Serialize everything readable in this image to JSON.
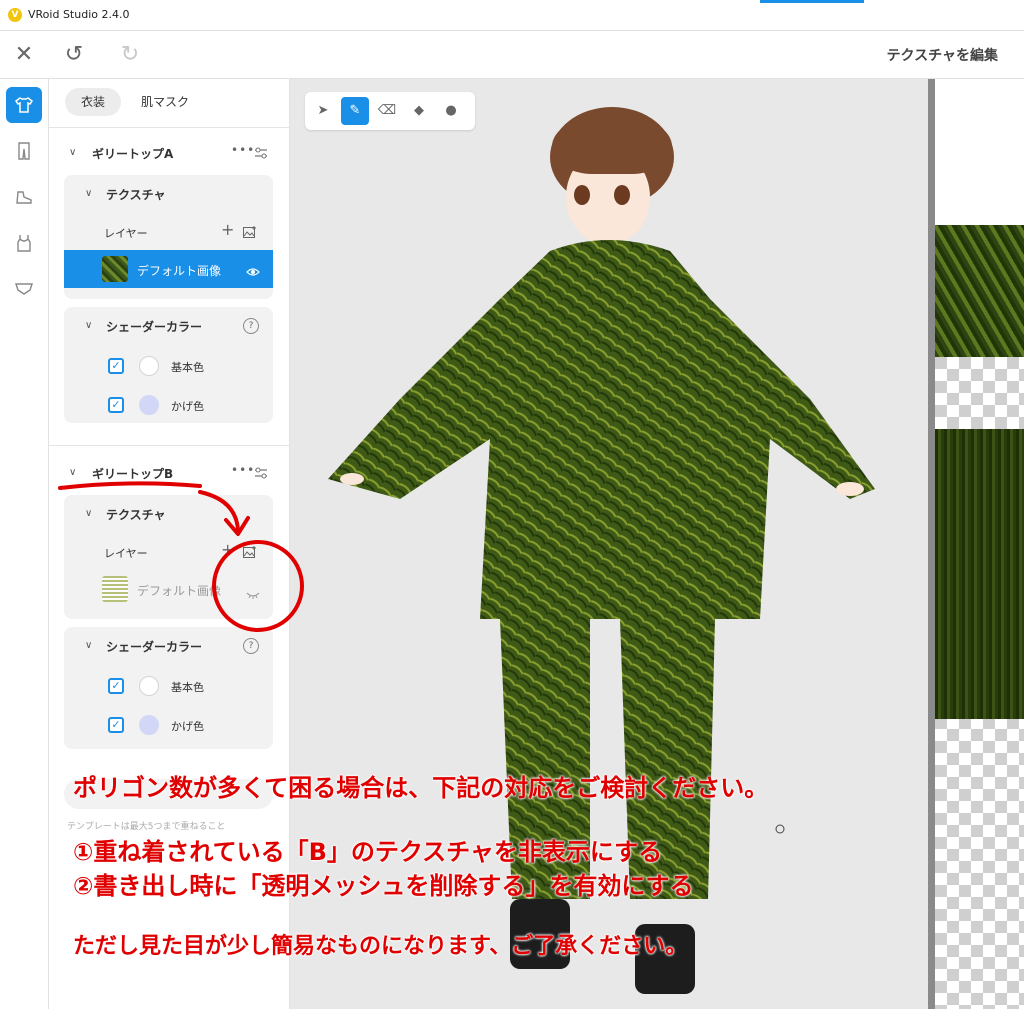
{
  "window": {
    "title": "VRoid Studio 2.4.0"
  },
  "toolbar": {
    "close_glyph": "✕",
    "undo_glyph": "↺",
    "redo_glyph": "↻",
    "right_title": "テクスチャを編集"
  },
  "icon_rail": [
    "tshirt-icon",
    "pants-icon",
    "shoe-icon",
    "tank-top-icon",
    "shield-icon"
  ],
  "panel": {
    "tabs": [
      {
        "label": "衣装",
        "active": true
      },
      {
        "label": "肌マスク",
        "active": false
      }
    ],
    "items": [
      {
        "title": "ギリートップA",
        "texture_title": "テクスチャ",
        "layer_label": "レイヤー",
        "layer_name": "デフォルト画像",
        "shader_title": "シェーダーカラー",
        "base_color_label": "基本色",
        "shade_color_label": "かげ色"
      },
      {
        "title": "ギリートップB",
        "texture_title": "テクスチャ",
        "layer_label": "レイヤー",
        "layer_name": "デフォルト画像",
        "shader_title": "シェーダーカラー",
        "base_color_label": "基本色",
        "shade_color_label": "かげ色"
      }
    ],
    "template_note": "テンプレートは最大5つまで重ねること"
  },
  "colors": {
    "accent": "#1a8fe8",
    "shade_swatch": "#d3d7f7",
    "base_swatch": "#ffffff",
    "annotation": "#e00000"
  },
  "annotation": {
    "line1": "ポリゴン数が多くて困る場合は、下記の対応をご検討ください。",
    "line2": "①重ね着されている「B」のテクスチャを非表示にする",
    "line3": "②書き出し時に「透明メッシュを削除する」を有効にする",
    "line4": "ただし見た目が少し簡易なものになります、ご了承ください。"
  }
}
